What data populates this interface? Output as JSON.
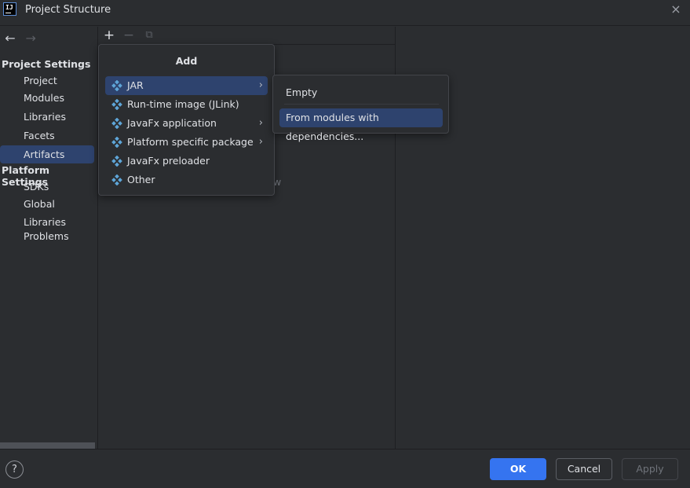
{
  "window": {
    "title": "Project Structure",
    "app_icon_text": "IJ",
    "close_icon": "×"
  },
  "nav": {
    "back_icon": "←",
    "forward_icon": "→"
  },
  "sidebar": {
    "project_settings_header": "Project Settings",
    "project_items": [
      {
        "label": "Project"
      },
      {
        "label": "Modules"
      },
      {
        "label": "Libraries"
      },
      {
        "label": "Facets"
      },
      {
        "label": "Artifacts",
        "selected": true
      }
    ],
    "platform_settings_header": "Platform Settings",
    "platform_items": [
      {
        "label": "SDKs"
      },
      {
        "label": "Global Libraries"
      }
    ],
    "problems_label": "Problems"
  },
  "toolbar": {
    "add_icon": "+",
    "remove_icon": "−",
    "copy_icon": "⧉"
  },
  "content": {
    "hint_fragment": "w"
  },
  "add_popup": {
    "title": "Add",
    "items": [
      {
        "label": "JAR",
        "has_submenu": true,
        "selected": true
      },
      {
        "label": "Run-time image (JLink)",
        "has_submenu": false
      },
      {
        "label": "JavaFx application",
        "has_submenu": true
      },
      {
        "label": "Platform specific package",
        "has_submenu": true
      },
      {
        "label": "JavaFx preloader",
        "has_submenu": false
      },
      {
        "label": "Other",
        "has_submenu": false
      }
    ],
    "chevron": "›"
  },
  "jar_submenu": {
    "items": [
      {
        "label": "Empty",
        "selected": false
      },
      {
        "label": "From modules with dependencies...",
        "selected": true
      }
    ]
  },
  "footer": {
    "help_label": "?",
    "ok_label": "OK",
    "cancel_label": "Cancel",
    "apply_label": "Apply"
  },
  "colors": {
    "background": "#2b2d30",
    "selection": "#2e436e",
    "primary_button": "#3574f0",
    "artifact_icon": "#5ea5d8"
  }
}
